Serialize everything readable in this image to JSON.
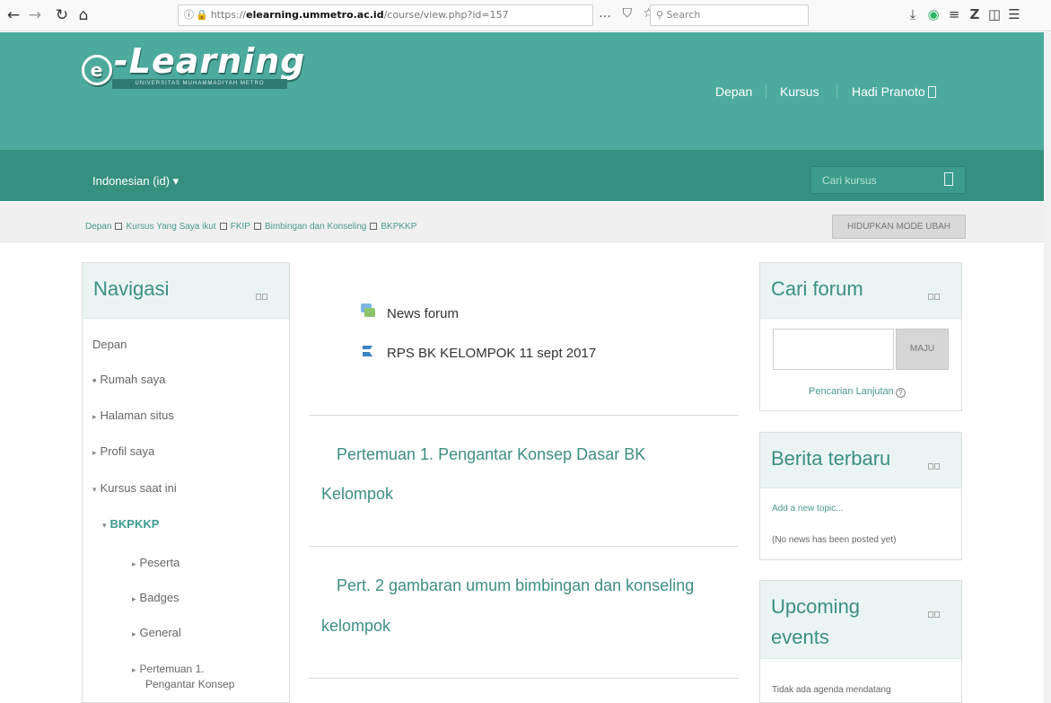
{
  "browser": {
    "back_icon": "←",
    "forward_icon": "→",
    "reload_icon": "↻",
    "home_icon": "⌂",
    "url_prefix": "https://",
    "url_host": "elearning.ummetro.ac.id",
    "url_path": "/course/view.php?id=157",
    "page_actions": "… ⛉ ☆",
    "search_placeholder": "Search"
  },
  "header": {
    "logo_text": "-Learning",
    "logo_mark": "e",
    "logo_subtitle": "UNIVERSITAS MUHAMMADIYAH METRO",
    "menu": [
      "Depan",
      "Kursus",
      "Hadi Pranoto"
    ],
    "language": "Indonesian (id) ▾",
    "course_search_placeholder": "Cari kursus"
  },
  "breadcrumb": [
    "Depan",
    "Kursus Yang Saya ikut",
    "FKIP",
    "Bimbingan dan Konseling",
    "BKPKKP"
  ],
  "edit_mode_button": "HIDUPKAN MODE UBAH",
  "navigation": {
    "title": "Navigasi",
    "items": [
      {
        "label": "Depan",
        "arrow": ""
      },
      {
        "label": "Rumah saya",
        "arrow": "●"
      },
      {
        "label": "Halaman situs",
        "arrow": "▸"
      },
      {
        "label": "Profil saya",
        "arrow": "▸"
      },
      {
        "label": "Kursus saat ini",
        "arrow": "▾"
      },
      {
        "label": "BKPKKP",
        "arrow": "▾"
      },
      {
        "label": "Peserta",
        "arrow": "▸"
      },
      {
        "label": "Badges",
        "arrow": "▸"
      },
      {
        "label": "General",
        "arrow": "▸"
      },
      {
        "label": "Pertemuan 1.",
        "arrow": "▸"
      },
      {
        "label": "Pengantar Konsep",
        "arrow": ""
      }
    ]
  },
  "main": {
    "activities": [
      "News forum",
      "RPS BK KELOMPOK 11 sept 2017"
    ],
    "sections": [
      {
        "line1": "Pertemuan 1. Pengantar Konsep Dasar BK",
        "line2": "Kelompok"
      },
      {
        "line1": "Pert. 2 gambaran umum bimbingan dan konseling",
        "line2": "kelompok"
      }
    ]
  },
  "forum_search": {
    "title": "Cari forum",
    "button": "MAJU",
    "advanced_link": "Pencarian Lanjutan",
    "help_icon": "?"
  },
  "news": {
    "title": "Berita terbaru",
    "add_link": "Add a new topic...",
    "empty_text": "(No news has been posted yet)"
  },
  "events": {
    "title_line1": "Upcoming",
    "title_line2": "events",
    "empty_text": "Tidak ada agenda mendatang"
  },
  "colors": {
    "brand": "#4daa9e",
    "brand_dark": "#36907f",
    "link": "#3d8e82"
  }
}
